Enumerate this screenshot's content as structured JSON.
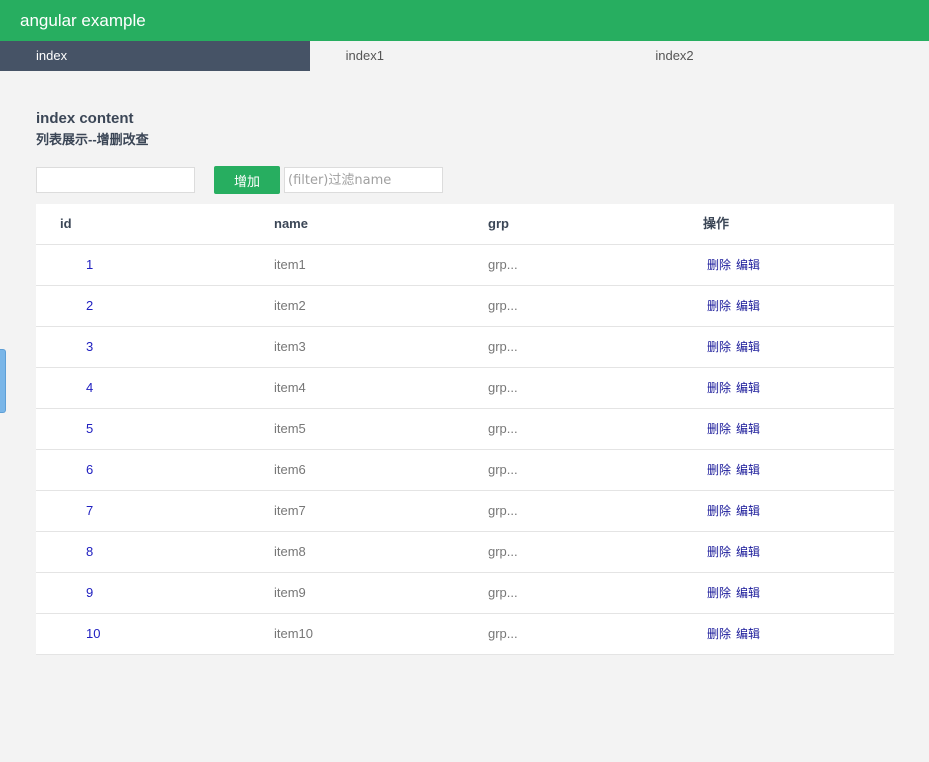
{
  "app": {
    "title": "angular example"
  },
  "tabs": [
    {
      "label": "index",
      "active": true
    },
    {
      "label": "index1",
      "active": false
    },
    {
      "label": "index2",
      "active": false
    }
  ],
  "content": {
    "title": "index content",
    "subtitle": "列表展示--增删改查"
  },
  "controls": {
    "add_input_value": "",
    "add_button_label": "增加",
    "filter_placeholder": "(filter)过滤name",
    "filter_value": ""
  },
  "table": {
    "headers": {
      "id": "id",
      "name": "name",
      "grp": "grp",
      "op": "操作"
    },
    "delete_label": "删除",
    "edit_label": "编辑",
    "rows": [
      {
        "id": "1",
        "name": "item1",
        "grp": "grp..."
      },
      {
        "id": "2",
        "name": "item2",
        "grp": "grp..."
      },
      {
        "id": "3",
        "name": "item3",
        "grp": "grp..."
      },
      {
        "id": "4",
        "name": "item4",
        "grp": "grp..."
      },
      {
        "id": "5",
        "name": "item5",
        "grp": "grp..."
      },
      {
        "id": "6",
        "name": "item6",
        "grp": "grp..."
      },
      {
        "id": "7",
        "name": "item7",
        "grp": "grp..."
      },
      {
        "id": "8",
        "name": "item8",
        "grp": "grp..."
      },
      {
        "id": "9",
        "name": "item9",
        "grp": "grp..."
      },
      {
        "id": "10",
        "name": "item10",
        "grp": "grp..."
      }
    ]
  },
  "colors": {
    "header_green": "#27ae60",
    "active_tab": "#465366",
    "link_blue": "#1a1a9a"
  }
}
